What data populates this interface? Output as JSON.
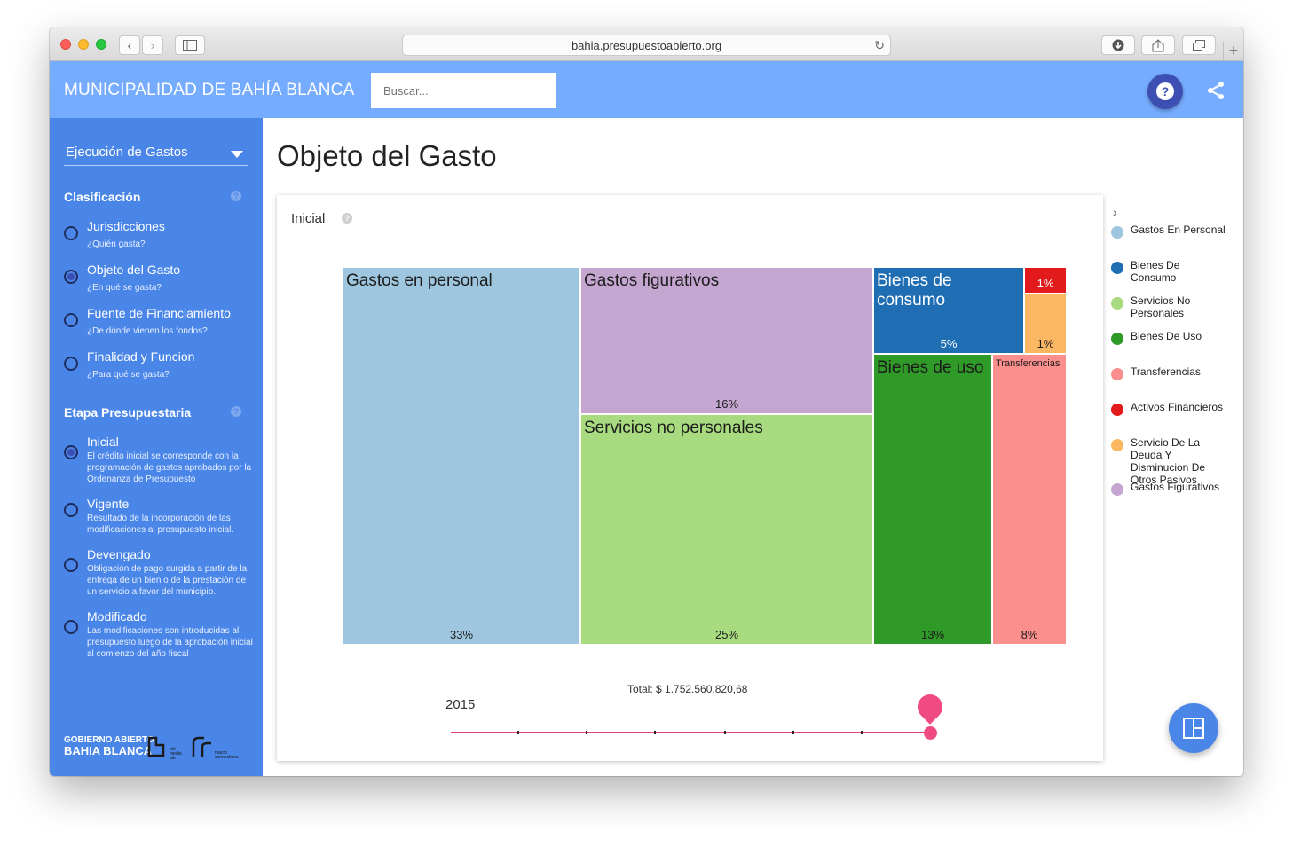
{
  "browser": {
    "url": "bahia.presupuestoabierto.org"
  },
  "header": {
    "brand": "MUNICIPALIDAD DE BAHÍA BLANCA",
    "search_placeholder": "Buscar...",
    "help_label": "?"
  },
  "sidebar": {
    "dropdown_value": "Ejecución de Gastos",
    "clasificacion": {
      "title": "Clasificación",
      "items": [
        {
          "label": "Jurisdicciones",
          "sub": "¿Quién gasta?",
          "selected": false
        },
        {
          "label": "Objeto del Gasto",
          "sub": "¿En qué se gasta?",
          "selected": true
        },
        {
          "label": "Fuente de Financiamiento",
          "sub": "¿De dónde vienen los fondos?",
          "selected": false
        },
        {
          "label": "Finalidad y Funcion",
          "sub": "¿Para qué se gasta?",
          "selected": false
        }
      ]
    },
    "etapa": {
      "title": "Etapa Presupuestaria",
      "items": [
        {
          "label": "Inicial",
          "sub": "El crédito inicial se corresponde con la programación de gastos aprobados por la Ordenanza de Presupuesto",
          "selected": true
        },
        {
          "label": "Vigente",
          "sub": "Resultado de la incorporación de las modificaciones al presupuesto inicial.",
          "selected": false
        },
        {
          "label": "Devengado",
          "sub": "Obligación de pago surgida a partir de la entrega de un bien o de la prestación de un servicio a favor del municipio.",
          "selected": false
        },
        {
          "label": "Modificado",
          "sub": "Las modificaciones son introducidas al presupuesto luego de la aprobación inicial al comienzo del año fiscal",
          "selected": false
        }
      ]
    },
    "footer": {
      "line1": "GOBIERNO ABIERTO",
      "line2": "BAHIA BLANCA"
    }
  },
  "main": {
    "title": "Objeto del Gasto",
    "card_label": "Inicial",
    "total": "Total: $ 1.752.560.820,68",
    "year": "2015",
    "timeline_position": 1.0
  },
  "chart_data": {
    "type": "treemap",
    "items": [
      {
        "name": "Gastos en personal",
        "percent_label": "33%",
        "color": "#9ec6df"
      },
      {
        "name": "Gastos figurativos",
        "percent_label": "16%",
        "color": "#c4a6d0"
      },
      {
        "name": "Servicios no personales",
        "percent_label": "25%",
        "color": "#a8da80"
      },
      {
        "name": "Bienes de consumo",
        "percent_label": "5%",
        "color": "#1f6eb4"
      },
      {
        "name": "",
        "percent_label": "1%",
        "color": "#e31a1c"
      },
      {
        "name": "",
        "percent_label": "1%",
        "color": "#fcb763"
      },
      {
        "name": "Bienes de uso",
        "percent_label": "13%",
        "color": "#2f9a27"
      },
      {
        "name": "Transferencias",
        "percent_label": "8%",
        "color": "#fb8f8d"
      }
    ]
  },
  "legend": [
    {
      "label": "Gastos En Personal",
      "color": "#9ec6df"
    },
    {
      "label": "Bienes De Consumo",
      "color": "#1f6eb4"
    },
    {
      "label": "Servicios No Personales",
      "color": "#a8da80"
    },
    {
      "label": "Bienes De Uso",
      "color": "#2f9a27"
    },
    {
      "label": "Transferencias",
      "color": "#fb8f8d"
    },
    {
      "label": "Activos Financieros",
      "color": "#e31a1c"
    },
    {
      "label": "Servicio De La Deuda Y Disminucion De Otros Pasivos",
      "color": "#fcb763"
    },
    {
      "label": "Gastos Figurativos",
      "color": "#c4a6d0"
    }
  ]
}
